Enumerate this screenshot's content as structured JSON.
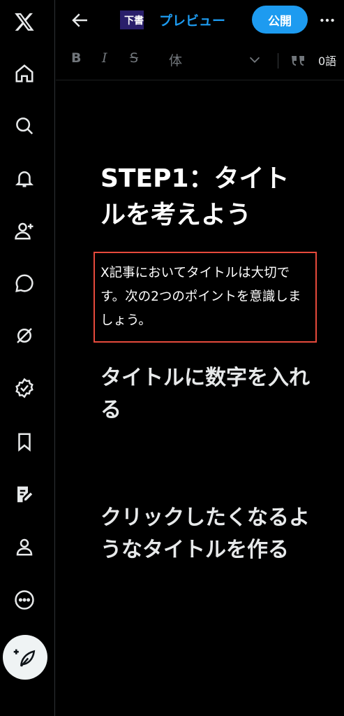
{
  "topbar": {
    "draft_label": "下書",
    "preview_label": "プレビュー",
    "publish_label": "公開"
  },
  "toolbar": {
    "bold_label": "B",
    "italic_label": "I",
    "strike_label": "S",
    "style_label": "体",
    "word_count": "0語"
  },
  "sidebar": {
    "items": [
      {
        "icon": "x-logo-icon"
      },
      {
        "icon": "home-icon"
      },
      {
        "icon": "search-icon"
      },
      {
        "icon": "bell-icon"
      },
      {
        "icon": "add-user-icon"
      },
      {
        "icon": "chat-icon"
      },
      {
        "icon": "grok-icon"
      },
      {
        "icon": "verified-icon"
      },
      {
        "icon": "bookmark-icon"
      },
      {
        "icon": "articles-icon"
      },
      {
        "icon": "profile-icon"
      },
      {
        "icon": "more-circle-icon"
      }
    ],
    "compose_icon": "compose-feather-icon"
  },
  "article": {
    "heading": "STEP1：タイトルを考えよう",
    "paragraph": "X記事においてタイトルは大切です。次の2つのポイントを意識しましょう。",
    "subheading1": "タイトルに数字を入れる",
    "subheading2": "クリックしたくなるようなタイトルを作る"
  },
  "colors": {
    "accent": "#1d9bf0",
    "highlight_box": "#e64a3c",
    "background": "#000000"
  }
}
